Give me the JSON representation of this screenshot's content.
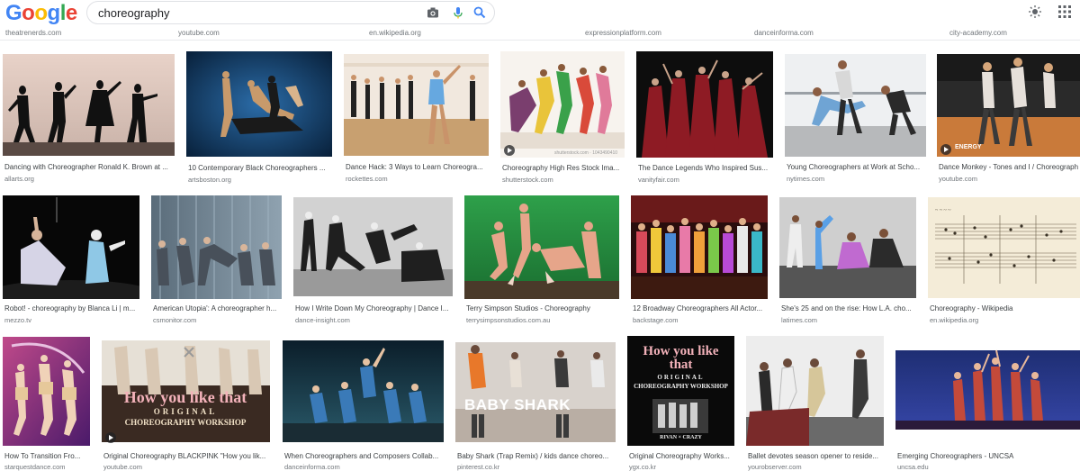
{
  "header": {
    "logo_letters": [
      {
        "ch": "G",
        "color": "#4285F4"
      },
      {
        "ch": "o",
        "color": "#EA4335"
      },
      {
        "ch": "o",
        "color": "#FBBC05"
      },
      {
        "ch": "g",
        "color": "#4285F4"
      },
      {
        "ch": "l",
        "color": "#34A853"
      },
      {
        "ch": "e",
        "color": "#EA4335"
      }
    ],
    "query": "choreography",
    "icons": [
      "camera-icon",
      "mic-icon",
      "search-icon",
      "brightness-icon",
      "apps-icon"
    ]
  },
  "top_sources": [
    "theatrenerds.com",
    "youtube.com",
    "en.wikipedia.org",
    "expressionplatform.com",
    "danceinforma.com",
    "city-academy.com"
  ],
  "rows": [
    [
      {
        "caption": "Dancing with Choreographer Ronald K. Brown at ...",
        "source": "allarts.org"
      },
      {
        "caption": "10 Contemporary Black Choreographers ...",
        "source": "artsboston.org"
      },
      {
        "caption": "Dance Hack: 3 Ways to Learn Choreogra...",
        "source": "rockettes.com"
      },
      {
        "caption": "Choreography High Res Stock Ima...",
        "source": "shutterstock.com"
      },
      {
        "caption": "The Dance Legends Who Inspired Sus...",
        "source": "vanityfair.com"
      },
      {
        "caption": "Young Choreographers at Work at Scho...",
        "source": "nytimes.com"
      },
      {
        "caption": "Dance Monkey - Tones and I / Choreograph",
        "source": "youtube.com"
      }
    ],
    [
      {
        "caption": "Robot! - choreography by Blanca Li | m...",
        "source": "mezzo.tv"
      },
      {
        "caption": "American Utopia': A choreographer h...",
        "source": "csmonitor.com"
      },
      {
        "caption": "How I Write Down My Choreography | Dance I...",
        "source": "dance-insight.com"
      },
      {
        "caption": "Terry Simpson Studios - Choreography",
        "source": "terrysimpsonstudios.com.au"
      },
      {
        "caption": "12 Broadway Choreographers All Actor...",
        "source": "backstage.com"
      },
      {
        "caption": "She's 25 and on the rise: How L.A. cho...",
        "source": "latimes.com"
      },
      {
        "caption": "Choreography - Wikipedia",
        "source": "en.wikipedia.org"
      }
    ],
    [
      {
        "caption": "How To Transition Fro...",
        "source": "starquestdance.com"
      },
      {
        "caption": "Original Choreography BLACKPINK \"How you lik...",
        "source": "youtube.com"
      },
      {
        "caption": "When Choreographers and Composers Collab...",
        "source": "danceinforma.com"
      },
      {
        "caption": "Baby Shark (Trap Remix) / kids dance choreo...",
        "source": "pinterest.co.kr"
      },
      {
        "caption": "Original Choreography Works...",
        "source": "ygx.co.kr"
      },
      {
        "caption": "Ballet devotes season opener to reside...",
        "source": "yourobserver.com"
      },
      {
        "caption": "Emerging Choreographers - UNCSA",
        "source": "uncsa.edu"
      }
    ]
  ],
  "overlays": {
    "shutterstock_watermark": "shutterstock.com · 1043490410",
    "energy": "ENERGY",
    "hylt_line1": "How you like that",
    "hylt_orig": "ORIGINAL",
    "hylt_work": "CHOREOGRAPHY WORKSHOP",
    "baby_shark": "BABY SHARK",
    "hylt2_line1": "How you like that",
    "hylt2_orig": "ORIGINAL",
    "hylt2_work": "CHOREOGRAPHY WORKSHOP",
    "hylt2_footer": "RIVAN × CRAZY"
  },
  "colors": {
    "link_gray": "#70757a",
    "caption": "#3c4043",
    "border": "#dfe1e5",
    "accent_blue": "#4285F4"
  }
}
